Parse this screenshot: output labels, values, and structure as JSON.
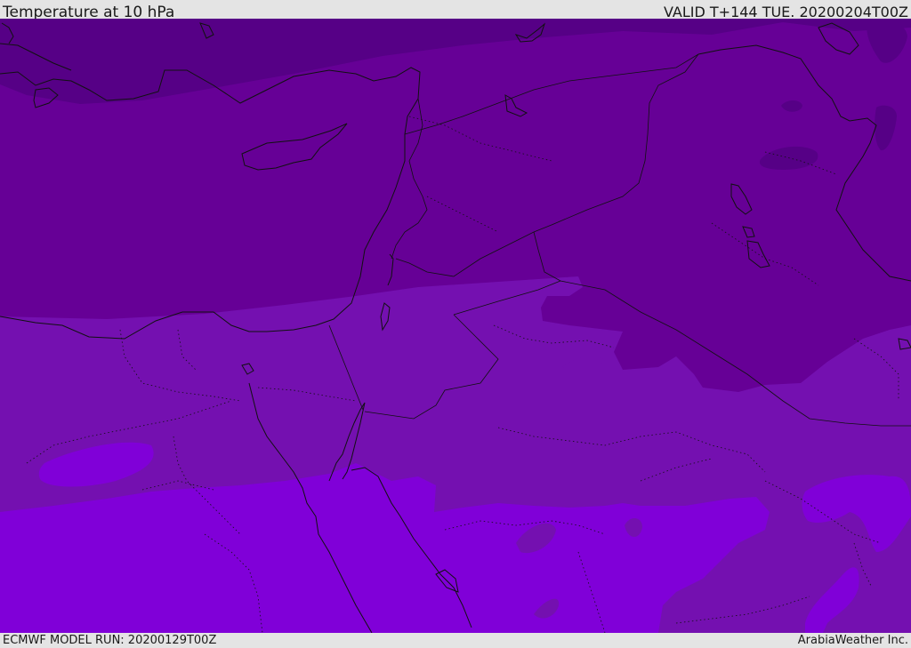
{
  "header": {
    "title": "Temperature at 10 hPa",
    "valid": "VALID T+144 TUE. 20200204T00Z"
  },
  "footer": {
    "model_run": "ECMWF MODEL RUN: 20200129T00Z",
    "credit": "ArabiaWeather Inc."
  },
  "colors": {
    "band_darkest": "#560086",
    "band_dark": "#660096",
    "band_mid": "#7410b0",
    "band_bright": "#8000d8",
    "border_line": "#111111",
    "bar_background": "#e4e4e4"
  }
}
